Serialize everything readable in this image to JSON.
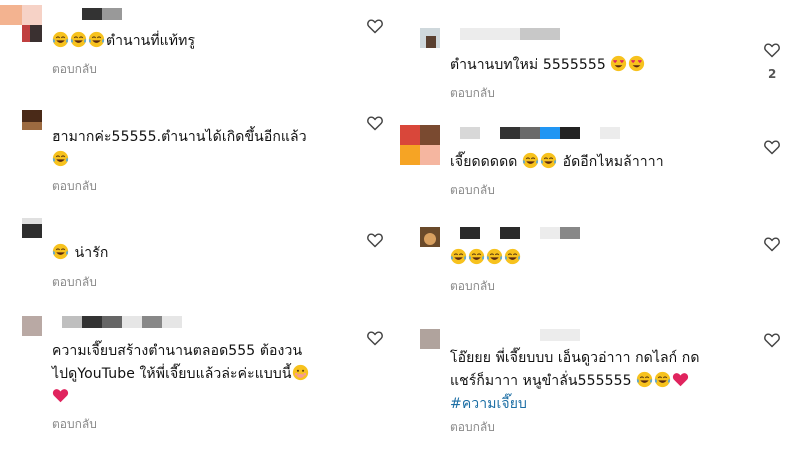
{
  "reply_label": "ตอบกลับ",
  "colors": {
    "accent_link": "#1d6fa5",
    "secondary_text": "#8a8a8a",
    "heart_red": "#e0245e"
  },
  "left_comments": [
    {
      "text": "ตำนานที่แท้ทรู",
      "emoji_before": [
        "laugh-cry",
        "laugh-cry",
        "laugh-cry"
      ]
    },
    {
      "text": "ฮามากค่ะ55555.ตำนานได้เกิดขึ้นอีกแล้ว",
      "emoji_after": [
        "laugh-cry"
      ]
    },
    {
      "text": "น่ารัก",
      "emoji_before": [
        "laugh-cry"
      ]
    },
    {
      "text_line1": "ความเจี๊ยบสร้างตำนานตลอด555 ต้องวน",
      "text_line2": "ไปดูYouTube ให้พี่เจี๊ยบแล้วล่ะค่ะแบบนี้",
      "emoji_after": [
        "hush"
      ],
      "extra": [
        "red-heart"
      ]
    }
  ],
  "right_comments": [
    {
      "text": "ตำนานบทใหม่ 5555555",
      "emoji_after": [
        "heart-eyes",
        "heart-eyes"
      ],
      "likes": "2"
    },
    {
      "text": "เจี๊ยดดดดด",
      "emoji_mid": [
        "laugh-cry",
        "laugh-cry"
      ],
      "text_after": "อัดอีกไหมล้าาาา"
    },
    {
      "text": "",
      "emoji_before": [
        "laugh-cry",
        "laugh-cry",
        "laugh-cry",
        "laugh-cry"
      ]
    },
    {
      "text_line1": "โอ๊ยยย พี่เจี๊ยบบบ เอ็นดูวอ่าาา กดไลก์ กด",
      "text_line2": "แชร์ก็มาาา หนูขำลั่น555555",
      "emoji_after": [
        "laugh-cry",
        "laugh-cry",
        "red-heart"
      ],
      "hashtag": "#ความเจี๊ยบ"
    }
  ]
}
